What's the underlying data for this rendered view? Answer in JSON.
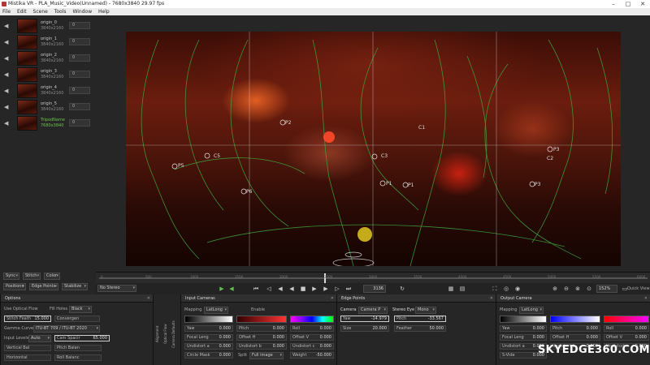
{
  "window": {
    "title": "Mistika VR - PLA_Music_Video(Unnamed) - 7680x3840 29.97 fps"
  },
  "menu": [
    "File",
    "Edit",
    "Scene",
    "Tools",
    "Window",
    "Help"
  ],
  "clips": [
    {
      "name": "origin_0",
      "res": "3840x2160",
      "num": "0"
    },
    {
      "name": "origin_1",
      "res": "3840x2160",
      "num": "0"
    },
    {
      "name": "origin_2",
      "res": "3840x2160",
      "num": "0"
    },
    {
      "name": "origin_3",
      "res": "3840x2160",
      "num": "0"
    },
    {
      "name": "origin_4",
      "res": "3840x2160",
      "num": "0"
    },
    {
      "name": "origin_5",
      "res": "3840x2160",
      "num": "0"
    },
    {
      "name": "TripodName",
      "res": "7680x3840",
      "num": "0"
    }
  ],
  "viewer_labels": {
    "p0": "P0",
    "p1": "P1",
    "p2": "P2",
    "p3": "P3",
    "p4": "P4",
    "p5": "P5",
    "p6": "P6",
    "c1": "C1",
    "c2": "C2",
    "c3": "C3",
    "c5": "C5"
  },
  "controls": {
    "sync": "Sync",
    "stitch": "Stitch",
    "color": "Color",
    "positions": "Positions",
    "edge_points": "Edge Points",
    "stabilize": "Stabilize",
    "no_stereo": "No Stereo",
    "frame": "3136",
    "zoom": "152%",
    "quick_view": "Quick View"
  },
  "timeline_ticks": [
    "0",
    "500",
    "1000",
    "1500",
    "2000",
    "2500",
    "3000",
    "3500",
    "4000",
    "4500",
    "5000",
    "5500",
    "6000"
  ],
  "options": {
    "title": "Options",
    "use_optical_flow": "Use Optical Flow",
    "fill_holes": "Fill Holes",
    "fill_holes_value": "Black",
    "stitch_feather_label": "Stitch Feath",
    "stitch_feather_value": "15.000",
    "convergence": "Convergen",
    "gamma_curve": "Gamma Curve",
    "gamma_value": "ITU-BT 709 / ITU-BT 2020",
    "input_levels": "Input Levels",
    "input_levels_value": "Auto",
    "cam_spacing": "Cam Spacir",
    "cam_spacing_value": "65.000",
    "vertical_bal": "Vertical Bal",
    "pitch_bal": "Pitch Balan",
    "horizontal": "Horizontal",
    "roll_bal": "Roll Balanc"
  },
  "vertical_tabs": [
    "Alignment",
    "Optical Flow",
    "Camera Defaults"
  ],
  "input_cameras": {
    "title": "Input Cameras",
    "mapping": "Mapping",
    "mapping_value": "LatLong",
    "enable": "Enable",
    "yaw": "Yaw",
    "yaw_value": "0.000",
    "pitch": "Pitch",
    "pitch_value": "0.000",
    "roll": "Roll",
    "roll_value": "0.000",
    "focal": "Focal Leng",
    "focal_value": "0.000",
    "offset_h": "Offset H",
    "offset_h_value": "0.000",
    "offset_v": "Offset V",
    "offset_v_value": "0.000",
    "undistort_a": "Undistort a",
    "undistort_a_value": "0.000",
    "undistort_b": "Undistort b",
    "undistort_b_value": "0.000",
    "undistort_c": "Undistort c",
    "undistort_c_value": "0.000",
    "circle_mask": "Circle Mask",
    "circle_mask_value": "0.000",
    "split": "Split",
    "split_value": "Full image",
    "weight": "Weight",
    "weight_value": "-50.000"
  },
  "edge_points": {
    "title": "Edge Points",
    "camera": "Camera",
    "camera_value": "Camera P",
    "stereo_eye": "Stereo Eye",
    "stereo_eye_value": "Mono",
    "yaw": "Yaw",
    "yaw_value": "-14.979",
    "pitch": "Pitch",
    "pitch_value": "-33.567",
    "size": "Size",
    "size_value": "20.000",
    "feather": "Feather",
    "feather_value": "50.000"
  },
  "output_camera": {
    "title": "Output Camera",
    "mapping": "Mapping",
    "mapping_value": "LatLong",
    "yaw": "Yaw",
    "yaw_value": "0.000",
    "pitch": "Pitch",
    "pitch_value": "0.000",
    "roll": "Roll",
    "roll_value": "0.000",
    "focal": "Focal Leng",
    "focal_value": "0.000",
    "offset_h": "Offset H",
    "offset_h_value": "0.000",
    "offset_v": "Offset V",
    "offset_v_value": "0.000",
    "undistort_a": "Undistort a",
    "undistort_a_value": "0.000",
    "undistort_b": "Undistort b",
    "undistort_b_value": "0.000",
    "undistort_c": "Undistort c",
    "undistort_c_value": "0.000",
    "s_video": "S-Vide",
    "s_video_value": "0.000"
  },
  "watermark": "SKYEDGE360.COM"
}
